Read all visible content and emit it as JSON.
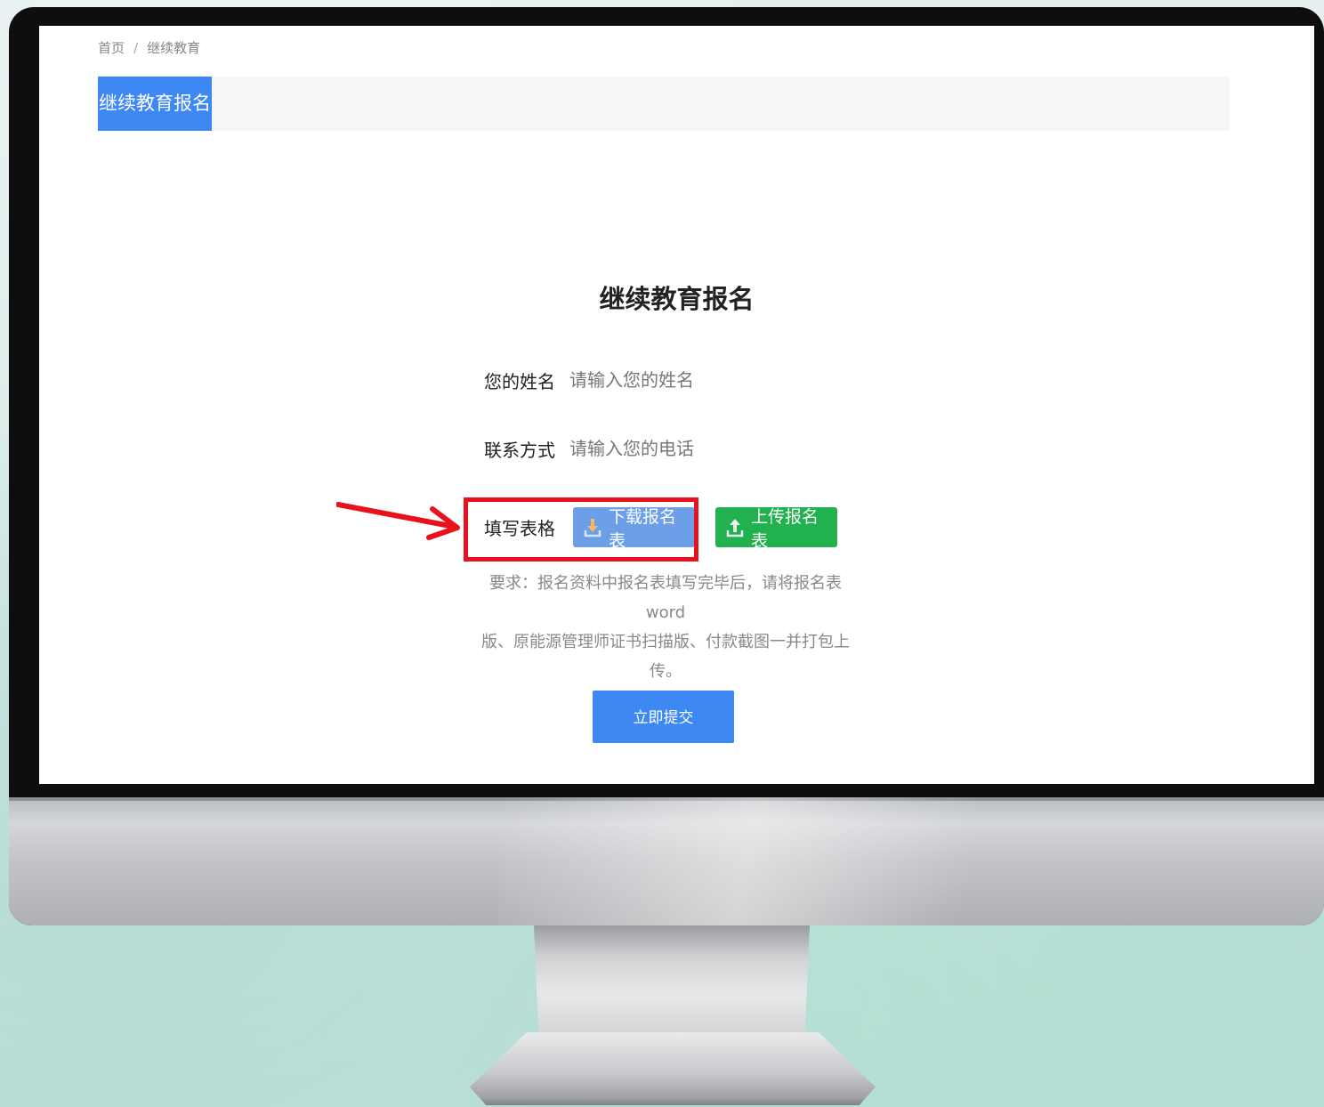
{
  "breadcrumb": {
    "home": "首页",
    "separator": "/",
    "current": "继续教育"
  },
  "tab": {
    "active_label": "继续教育报名"
  },
  "form": {
    "title": "继续教育报名",
    "name_label": "您的姓名",
    "name_placeholder": "请输入您的姓名",
    "phone_label": "联系方式",
    "phone_placeholder": "请输入您的电话",
    "file_label": "填写表格",
    "download_label": "下载报名表",
    "upload_label": "上传报名表",
    "note_line1": "要求：报名资料中报名表填写完毕后，请将报名表word",
    "note_line2": "版、原能源管理师证书扫描版、付款截图一并打包上传。",
    "submit_label": "立即提交"
  },
  "icons": {
    "download": "download-icon",
    "upload": "upload-icon"
  },
  "colors": {
    "primary": "#3e88f4",
    "download_button": "#6d9fe9",
    "upload_button": "#21b14f",
    "highlight": "#e8121c"
  }
}
